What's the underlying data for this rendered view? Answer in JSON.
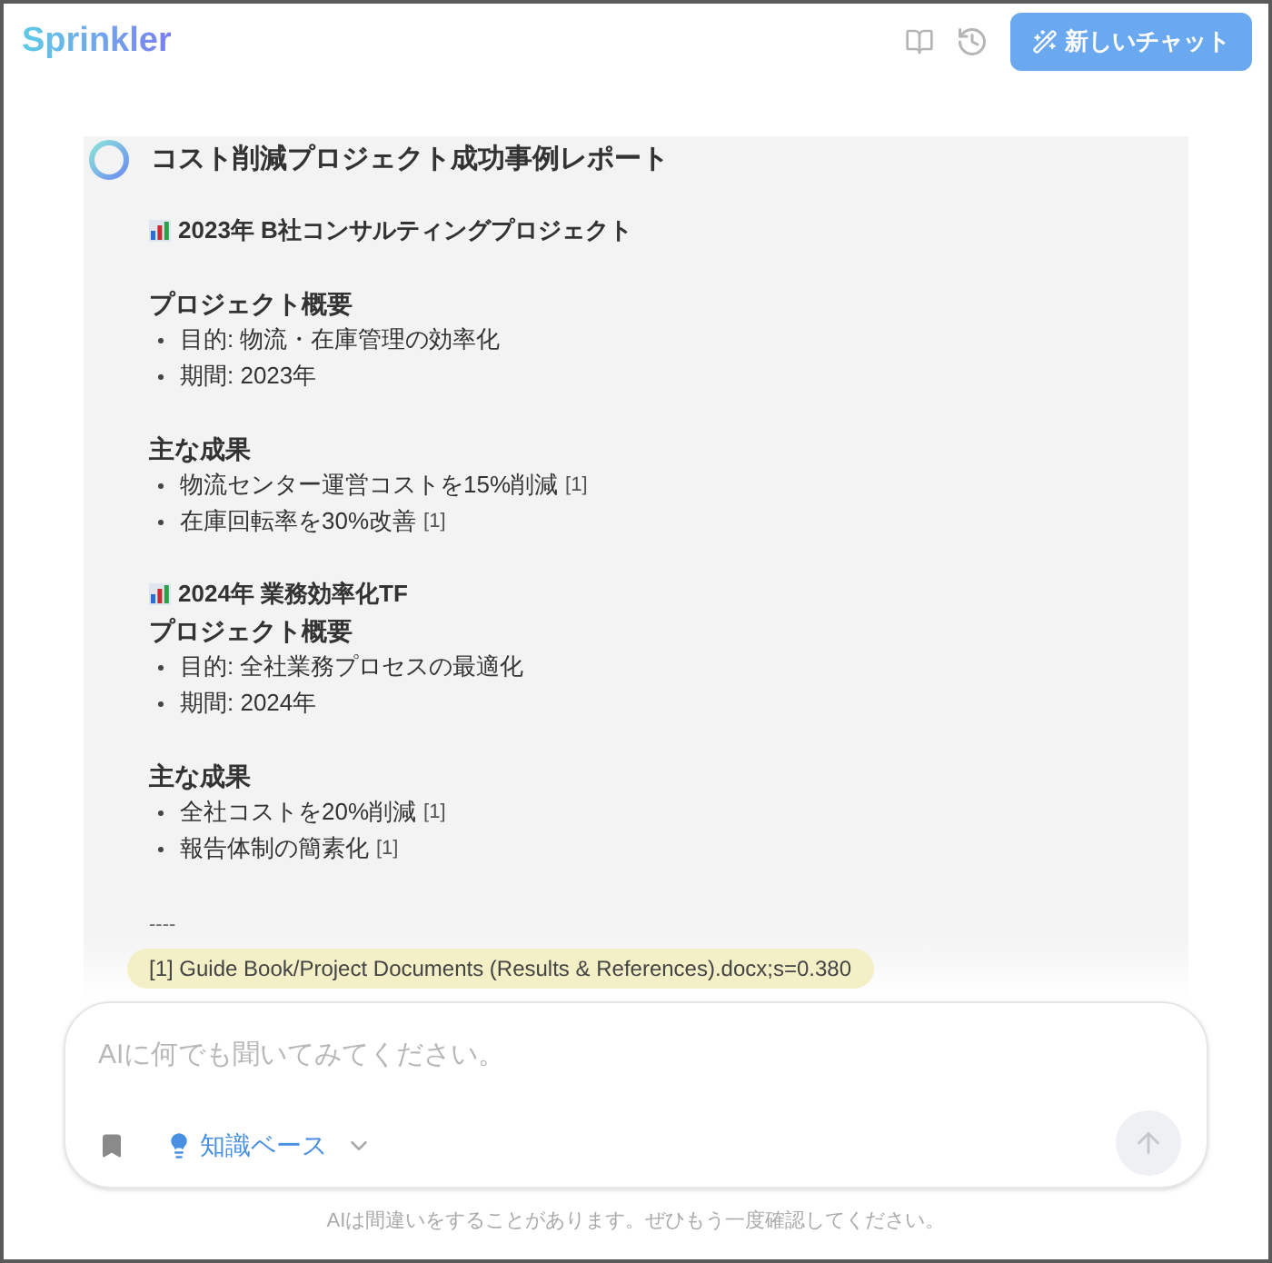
{
  "header": {
    "logo": "Sprinkler",
    "new_chat_button": "新しいチャット"
  },
  "message": {
    "title": "コスト削減プロジェクト成功事例レポート",
    "blocks": [
      {
        "kind": "project",
        "text": "2023年 B社コンサルティングプロジェクト"
      },
      {
        "kind": "spacer"
      },
      {
        "kind": "subheading",
        "text": "プロジェクト概要"
      },
      {
        "kind": "bullet",
        "text": "目的: 物流・在庫管理の効率化"
      },
      {
        "kind": "bullet",
        "text": "期間: 2023年"
      },
      {
        "kind": "spacer"
      },
      {
        "kind": "subheading",
        "text": "主な成果"
      },
      {
        "kind": "bullet",
        "text": "物流センター運営コストを15%削減",
        "ref": "[1]"
      },
      {
        "kind": "bullet",
        "text": "在庫回転率を30%改善",
        "ref": "[1]"
      },
      {
        "kind": "spacer"
      },
      {
        "kind": "project",
        "text": "2024年 業務効率化TF"
      },
      {
        "kind": "subheading",
        "text": "プロジェクト概要"
      },
      {
        "kind": "bullet",
        "text": "目的: 全社業務プロセスの最適化"
      },
      {
        "kind": "bullet",
        "text": "期間: 2024年"
      },
      {
        "kind": "spacer"
      },
      {
        "kind": "subheading",
        "text": "主な成果"
      },
      {
        "kind": "bullet",
        "text": "全社コストを20%削減",
        "ref": "[1]"
      },
      {
        "kind": "bullet",
        "text": "報告体制の簡素化",
        "ref": "[1]"
      },
      {
        "kind": "spacer"
      },
      {
        "kind": "rule",
        "text": "----"
      },
      {
        "kind": "citation",
        "text": "[1] Guide Book/Project Documents (Results & References).docx;s=0.380"
      }
    ]
  },
  "composer": {
    "placeholder": "AIに何でも聞いてみてください。",
    "knowledge_button": "知識ベース"
  },
  "disclaimer": "AIは間違いをすることがあります。ぜひもう一度確認してください。"
}
